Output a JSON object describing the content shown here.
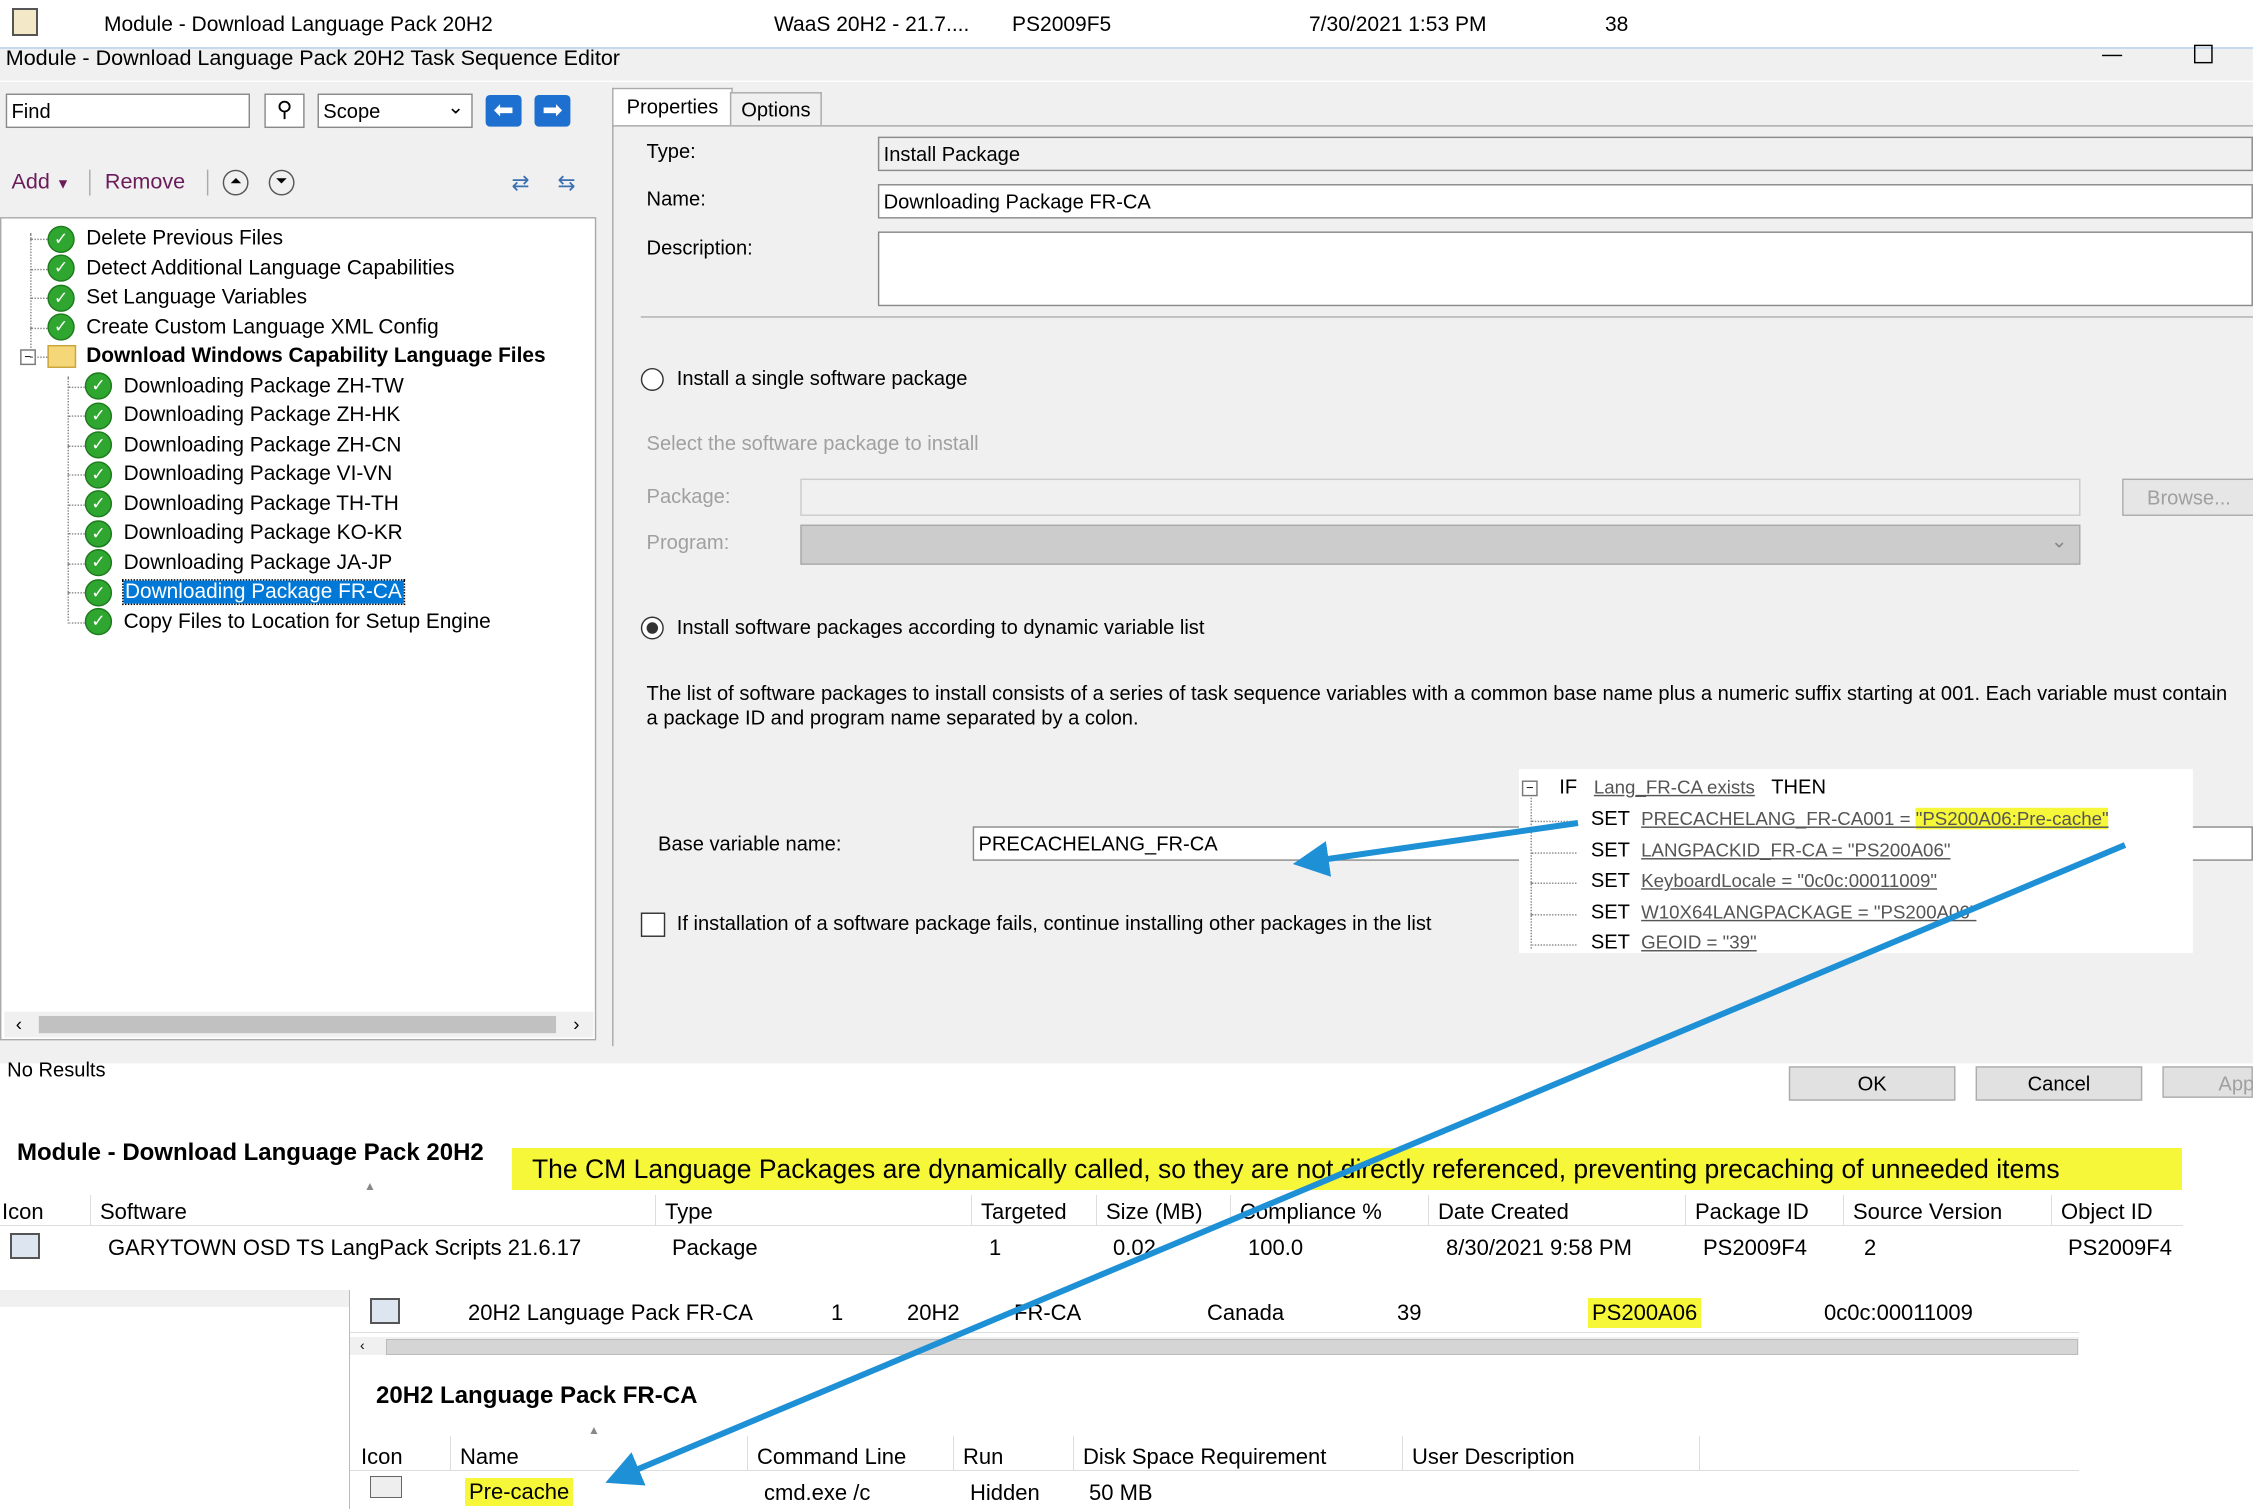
{
  "colors": {
    "accent": "#1e90d6",
    "highlight": "#f7f73a",
    "selection": "#0078d7",
    "check": "#2fa62f"
  },
  "top_row": {
    "name": "Module - Download Language Pack 20H2",
    "collection": "WaaS 20H2 - 21.7....",
    "package_id": "PS2009F5",
    "date": "7/30/2021 1:53 PM",
    "number": "38"
  },
  "editor": {
    "title": "Module - Download Language Pack 20H2 Task Sequence Editor",
    "find_placeholder": "Find",
    "scope_label": "Scope",
    "add_label": "Add",
    "remove_label": "Remove",
    "tree": [
      {
        "label": "Delete Previous Files",
        "level": 0
      },
      {
        "label": "Detect Additional Language Capabilities",
        "level": 0
      },
      {
        "label": "Set Language Variables",
        "level": 0
      },
      {
        "label": "Create Custom Language XML Config",
        "level": 0
      },
      {
        "label": "Download Windows Capability Language Files",
        "level": 0,
        "group": true
      },
      {
        "label": "Downloading Package ZH-TW",
        "level": 1
      },
      {
        "label": "Downloading Package ZH-HK",
        "level": 1
      },
      {
        "label": "Downloading Package ZH-CN",
        "level": 1
      },
      {
        "label": "Downloading Package VI-VN",
        "level": 1
      },
      {
        "label": "Downloading Package TH-TH",
        "level": 1
      },
      {
        "label": "Downloading Package KO-KR",
        "level": 1
      },
      {
        "label": "Downloading Package JA-JP",
        "level": 1
      },
      {
        "label": "Downloading Package FR-CA",
        "level": 1,
        "selected": true
      },
      {
        "label": "Copy Files to Location for Setup Engine",
        "level": 1
      }
    ],
    "status": "No Results",
    "tabs": {
      "properties": "Properties",
      "options": "Options"
    },
    "type_label": "Type:",
    "type_value": "Install Package",
    "name_label": "Name:",
    "name_value": "Downloading Package FR-CA",
    "description_label": "Description:",
    "radio_single": "Install a single software package",
    "select_pkg_hint": "Select the software package to install",
    "package_label": "Package:",
    "program_label": "Program:",
    "browse_label": "Browse...",
    "radio_dynamic": "Install software packages according to dynamic variable list",
    "dynamic_help": "The list of software packages to install consists of a series of task sequence variables with a common base name plus a numeric suffix starting at 001.  Each variable must contain a package ID and program name separated by a colon.",
    "base_var_label": "Base variable name:",
    "base_var_value": "PRECACHELANG_FR-CA",
    "continue_label": "If installation of a software package fails, continue installing other packages in the list",
    "ok_label": "OK",
    "cancel_label": "Cancel",
    "apply_label": "App"
  },
  "conditions": {
    "if": "IF",
    "cond": "Lang_FR-CA exists",
    "then": "THEN",
    "lines": [
      {
        "kw": "SET",
        "pre": "PRECACHELANG_FR-CA001 = ",
        "hl": "\"PS200A06:Pre-cache\""
      },
      {
        "kw": "SET",
        "pre": "LANGPACKID_FR-CA = \"PS200A06\"",
        "hl": ""
      },
      {
        "kw": "SET",
        "pre": "KeyboardLocale = \"0c0c:00011009\"",
        "hl": ""
      },
      {
        "kw": "SET",
        "pre": "W10X64LANGPACKAGE = \"PS200A06\"",
        "hl": ""
      },
      {
        "kw": "SET",
        "pre": "GEOID = \"39\"",
        "hl": ""
      }
    ]
  },
  "callout": "The CM Language Packages are dynamically called, so they are not directly referenced, preventing precaching of unneeded items",
  "ref_pane": {
    "title": "Module - Download Language Pack 20H2",
    "columns": [
      "Icon",
      "Software",
      "Type",
      "Targeted",
      "Size (MB)",
      "Compliance %",
      "Date Created",
      "Package ID",
      "Source Version",
      "Object ID"
    ],
    "row": [
      "",
      "GARYTOWN OSD TS LangPack Scripts 21.6.17",
      "Package",
      "1",
      "0.02",
      "100.0",
      "8/30/2021 9:58 PM",
      "PS2009F4",
      "2",
      "PS2009F4"
    ]
  },
  "lp_row": {
    "name": "20H2 Language Pack FR-CA",
    "n1": "1",
    "ver": "20H2",
    "lang": "FR-CA",
    "country": "Canada",
    "n2": "39",
    "pkg": "PS200A06",
    "locale": "0c0c:00011009"
  },
  "prog_pane": {
    "title": "20H2 Language Pack FR-CA",
    "columns": [
      "Icon",
      "Name",
      "Command Line",
      "Run",
      "Disk Space Requirement",
      "User Description"
    ],
    "row": {
      "name": "Pre-cache",
      "cmd": "cmd.exe /c",
      "run": "Hidden",
      "disk": "50 MB"
    }
  }
}
